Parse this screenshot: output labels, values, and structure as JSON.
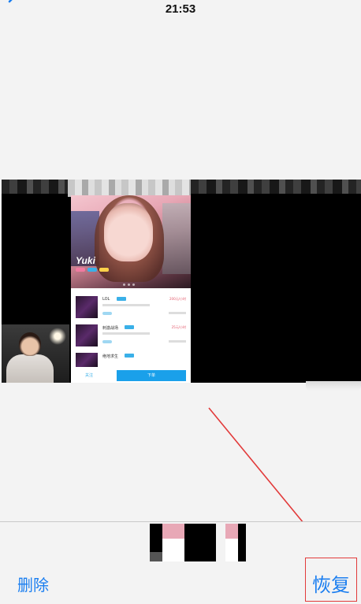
{
  "status_bar": {
    "time": "21:53"
  },
  "icons": {
    "back": "chevron-left-icon"
  },
  "preview": {
    "inner_app": {
      "hero_name": "Yuki",
      "list_items": [
        {
          "title": "LOL",
          "price": "200元/小时"
        },
        {
          "title": "刺激战场",
          "price": "25元/小时"
        },
        {
          "title": "绝地求生",
          "price": ""
        }
      ],
      "follow_label": "关注",
      "order_label": "下单"
    }
  },
  "toolbar": {
    "delete_label": "删除",
    "restore_label": "恢复"
  },
  "colors": {
    "accent_blue": "#1a7ef0",
    "annotation_red": "#e23a3a",
    "background": "#f3f3f3"
  }
}
